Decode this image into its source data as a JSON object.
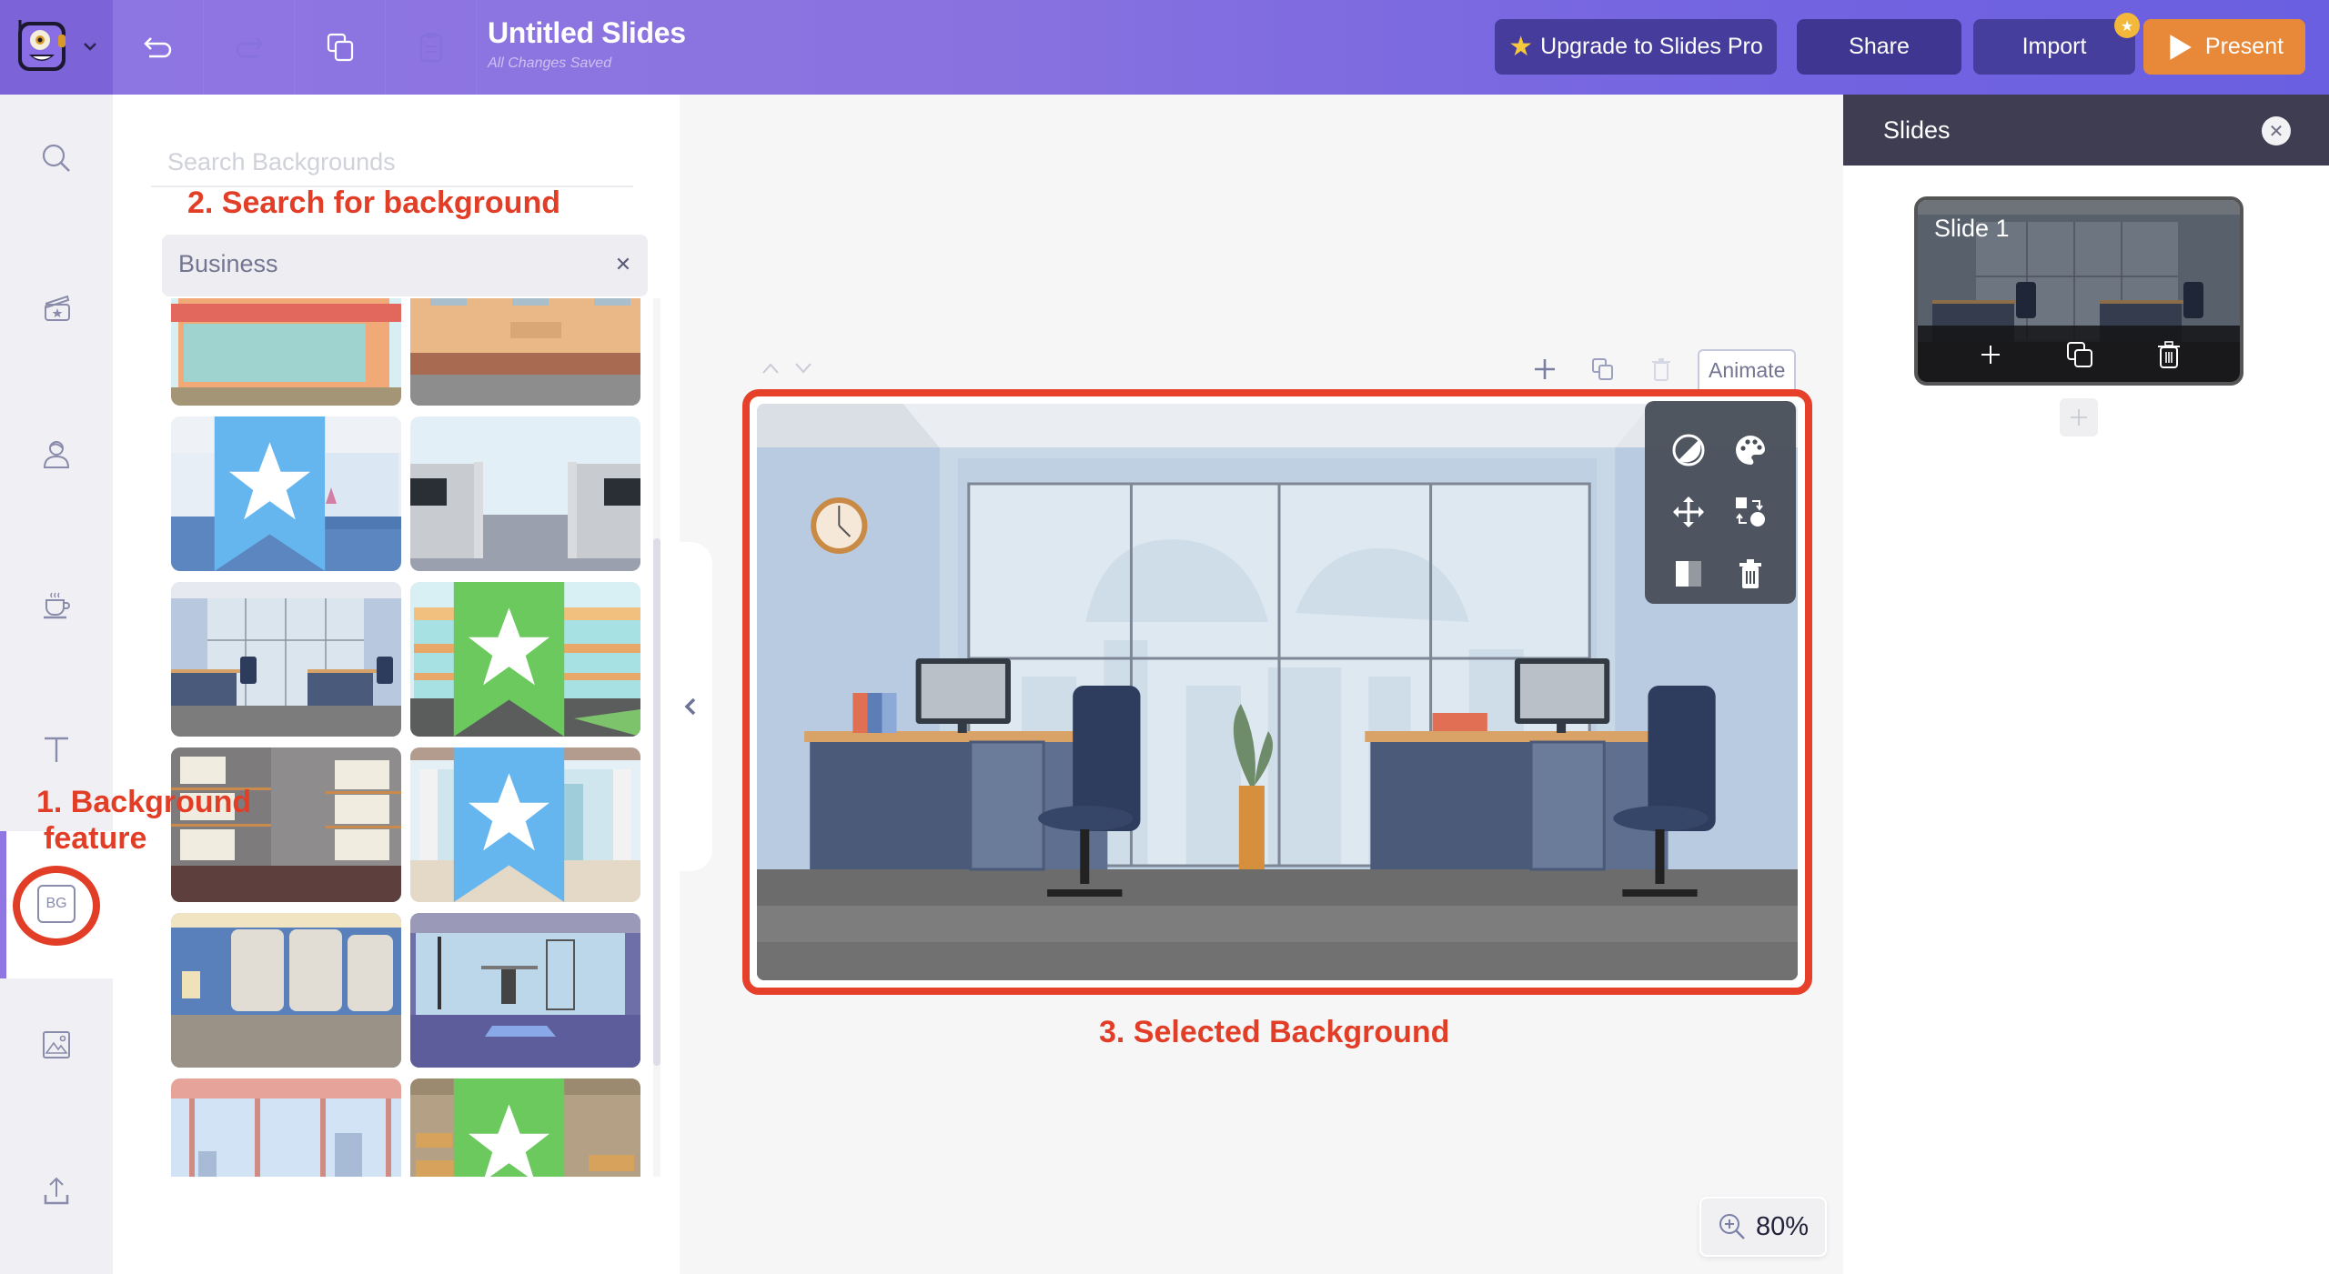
{
  "app": {
    "logo_icon": "monster-mascot-icon",
    "document_title": "Untitled Slides",
    "save_status": "All Changes Saved"
  },
  "toolbar": {
    "undo_icon": "undo-icon",
    "redo_icon": "redo-icon",
    "duplicate_icon": "duplicate-icon",
    "paste_icon": "clipboard-icon"
  },
  "header_actions": {
    "upgrade_label": "Upgrade to Slides Pro",
    "share_label": "Share",
    "import_label": "Import",
    "present_label": "Present",
    "colors": {
      "upgrade": "#453c9b",
      "share": "#3e3690",
      "import": "#463e9c",
      "present": "#e8893a"
    }
  },
  "rail": {
    "items": [
      {
        "name": "search",
        "icon": "search-icon"
      },
      {
        "name": "scenes",
        "icon": "clapperboard-icon"
      },
      {
        "name": "characters",
        "icon": "person-icon"
      },
      {
        "name": "props",
        "icon": "coffee-cup-icon"
      },
      {
        "name": "text",
        "icon": "text-icon"
      },
      {
        "name": "backgrounds",
        "icon": "bg-icon",
        "label": "BG",
        "active": true
      },
      {
        "name": "images",
        "icon": "image-icon"
      },
      {
        "name": "upload",
        "icon": "upload-icon"
      }
    ]
  },
  "background_panel": {
    "search_placeholder": "Search Backgrounds",
    "search_value": "",
    "active_tag": "Business",
    "thumbnails": [
      {
        "scene": "storefront",
        "badge": null
      },
      {
        "scene": "building-facade",
        "badge": null
      },
      {
        "scene": "reception",
        "badge": "blue-star"
      },
      {
        "scene": "cubicles",
        "badge": null
      },
      {
        "scene": "office",
        "badge": null,
        "selected": true
      },
      {
        "scene": "shopping-mall",
        "badge": "green-star"
      },
      {
        "scene": "warehouse-shelves",
        "badge": null
      },
      {
        "scene": "window-room",
        "badge": "blue-star"
      },
      {
        "scene": "factory-tanks",
        "badge": null
      },
      {
        "scene": "gym",
        "badge": null
      },
      {
        "scene": "glass-front",
        "badge": null
      },
      {
        "scene": "storage-warehouse",
        "badge": "green-star"
      }
    ]
  },
  "canvas": {
    "animate_label": "Animate",
    "zoom_level": "80%",
    "background_tools": [
      "contrast-icon",
      "palette-icon",
      "move-icon",
      "swap-icon",
      "flip-icon",
      "delete-icon"
    ]
  },
  "annotations": {
    "step1_line1": "1. Background",
    "step1_line2": "feature",
    "step2": "2. Search for background",
    "step3": "3. Selected Background",
    "color": "#e23e27"
  },
  "slides_panel": {
    "title": "Slides",
    "slides": [
      {
        "label": "Slide 1"
      }
    ]
  }
}
